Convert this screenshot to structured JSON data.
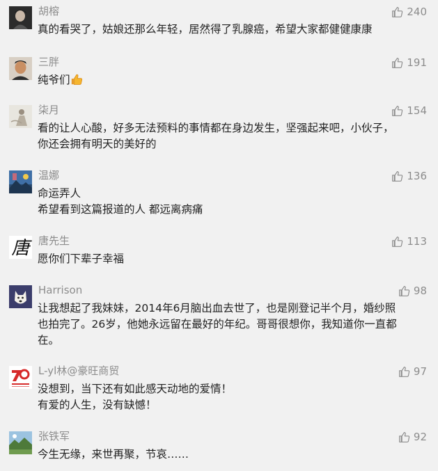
{
  "colors": {
    "background": "#f1f1f1",
    "username": "#8c8c8c",
    "text": "#222222",
    "like": "#8c8c8c"
  },
  "comments": [
    {
      "username": "胡榕",
      "likes": "240",
      "avatar_icon": "portrait-avatar-icon",
      "lines": [
        "真的看哭了，姑娘还那么年轻，居然得了乳腺癌，希望大家都健健康康"
      ]
    },
    {
      "username": "三胖",
      "likes": "191",
      "avatar_icon": "portrait-avatar-icon",
      "lines": [
        "纯爷们"
      ],
      "emoji": "thumbs-up-emoji-icon"
    },
    {
      "username": "柒月",
      "likes": "154",
      "avatar_icon": "figure-avatar-icon",
      "lines": [
        "看的让人心酸，好多无法预料的事情都在身边发生，坚强起来吧，小伙子，",
        "你还会拥有明天的美好的"
      ]
    },
    {
      "username": "温娜",
      "likes": "136",
      "avatar_icon": "landscape-avatar-icon",
      "lines": [
        "命运弄人",
        "希望看到这篇报道的人  都远离病痛"
      ]
    },
    {
      "username": "唐先生",
      "likes": "113",
      "avatar_icon": "calligraphy-avatar-icon",
      "avatar_text": "唐",
      "lines": [
        "愿你们下辈子幸福"
      ]
    },
    {
      "username": "Harrison",
      "likes": "98",
      "avatar_icon": "dog-avatar-icon",
      "lines": [
        "让我想起了我妹妹，2014年6月脑出血去世了，也是刚登记半个月，婚纱照",
        "也拍完了。26岁，他她永远留在最好的年纪。哥哥很想你，我知道你一直都",
        "在。"
      ]
    },
    {
      "username": "L-yl林@豪旺商贸",
      "likes": "97",
      "avatar_icon": "logo-avatar-icon",
      "lines": [
        "没想到，当下还有如此感天动地的爱情！",
        "有爱的人生，没有缺憾！"
      ]
    },
    {
      "username": "张铁军",
      "likes": "92",
      "avatar_icon": "scenery-avatar-icon",
      "lines": [
        "今生无缘，来世再聚，节哀……"
      ]
    }
  ]
}
